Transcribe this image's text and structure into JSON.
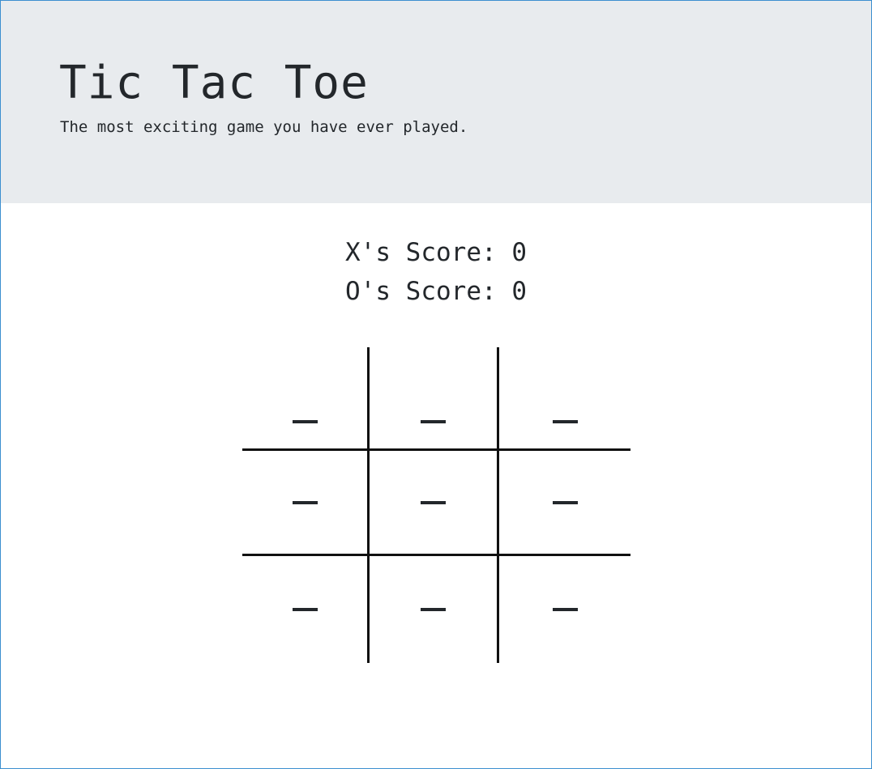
{
  "header": {
    "title": "Tic Tac Toe",
    "subtitle": "The most exciting game you have ever played."
  },
  "scores": {
    "x_label": "X's Score: 0",
    "o_label": "O's Score: 0"
  },
  "board": {
    "cells": [
      [
        "",
        "",
        ""
      ],
      [
        "",
        "",
        ""
      ],
      [
        "",
        "",
        ""
      ]
    ]
  }
}
